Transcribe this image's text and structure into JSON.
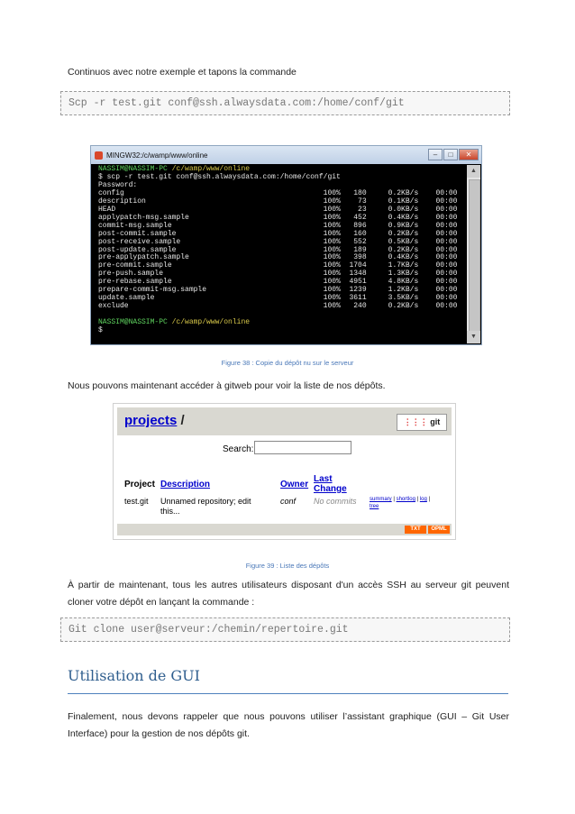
{
  "intro": "Continuos avec notre exemple et tapons la commande",
  "code1": "Scp -r test.git conf@ssh.alwaysdata.com:/home/conf/git",
  "terminal": {
    "title": "MINGW32:/c/wamp/www/online",
    "prompt_user": "NASSIM@NASSIM-PC",
    "prompt_path": "/c/wamp/www/online",
    "command": "$ scp -r test.git conf@ssh.alwaysdata.com:/home/conf/git",
    "password": "Password:",
    "files": [
      {
        "name": "config",
        "pct": "100%",
        "size": "180",
        "speed": "0.2KB/s",
        "time": "00:00"
      },
      {
        "name": "description",
        "pct": "100%",
        "size": "73",
        "speed": "0.1KB/s",
        "time": "00:00"
      },
      {
        "name": "HEAD",
        "pct": "100%",
        "size": "23",
        "speed": "0.0KB/s",
        "time": "00:00"
      },
      {
        "name": "applypatch-msg.sample",
        "pct": "100%",
        "size": "452",
        "speed": "0.4KB/s",
        "time": "00:00"
      },
      {
        "name": "commit-msg.sample",
        "pct": "100%",
        "size": "896",
        "speed": "0.9KB/s",
        "time": "00:00"
      },
      {
        "name": "post-commit.sample",
        "pct": "100%",
        "size": "160",
        "speed": "0.2KB/s",
        "time": "00:00"
      },
      {
        "name": "post-receive.sample",
        "pct": "100%",
        "size": "552",
        "speed": "0.5KB/s",
        "time": "00:00"
      },
      {
        "name": "post-update.sample",
        "pct": "100%",
        "size": "189",
        "speed": "0.2KB/s",
        "time": "00:00"
      },
      {
        "name": "pre-applypatch.sample",
        "pct": "100%",
        "size": "398",
        "speed": "0.4KB/s",
        "time": "00:00"
      },
      {
        "name": "pre-commit.sample",
        "pct": "100%",
        "size": "1704",
        "speed": "1.7KB/s",
        "time": "00:00"
      },
      {
        "name": "pre-push.sample",
        "pct": "100%",
        "size": "1348",
        "speed": "1.3KB/s",
        "time": "00:00"
      },
      {
        "name": "pre-rebase.sample",
        "pct": "100%",
        "size": "4951",
        "speed": "4.8KB/s",
        "time": "00:00"
      },
      {
        "name": "prepare-commit-msg.sample",
        "pct": "100%",
        "size": "1239",
        "speed": "1.2KB/s",
        "time": "00:00"
      },
      {
        "name": "update.sample",
        "pct": "100%",
        "size": "3611",
        "speed": "3.5KB/s",
        "time": "00:00"
      },
      {
        "name": "exclude",
        "pct": "100%",
        "size": "240",
        "speed": "0.2KB/s",
        "time": "00:00"
      }
    ],
    "final_prompt": "$"
  },
  "caption38": "Figure 38 : Copie du dépôt nu sur le serveur",
  "para2": "Nous pouvons maintenant accéder à gitweb pour voir la liste de nos dépôts.",
  "gitweb": {
    "title_link": "projects",
    "title_sep": "/",
    "logo": "git",
    "search_label": "Search:",
    "headers": {
      "project": "Project",
      "description": "Description",
      "owner": "Owner",
      "last_change_1": "Last",
      "last_change_2": "Change"
    },
    "row": {
      "project": "test.git",
      "description_1": "Unnamed repository; edit",
      "description_2": "this...",
      "owner": "conf",
      "last_change": "No commits",
      "link_summary": "summary",
      "link_shortlog": "shortlog",
      "link_log": "log",
      "link_tree": "tree"
    },
    "btn_txt": "TXT",
    "btn_opml": "OPML"
  },
  "caption39": "Figure 39 : Liste des dépôts",
  "para3_1": "À partir de maintenant, tous les autres utilisateurs disposant d'un accès SSH au serveur git peuvent",
  "para3_2": "cloner votre dépôt en lançant la commande :",
  "code2": "Git clone user@serveur:/chemin/repertoire.git",
  "heading": "Utilisation de GUI",
  "para4_1": "Finalement, nous devons rappeler que nous pouvons utiliser l’assistant graphique (GUI – Git User",
  "para4_2": "Interface) pour la gestion de nos dépôts git."
}
